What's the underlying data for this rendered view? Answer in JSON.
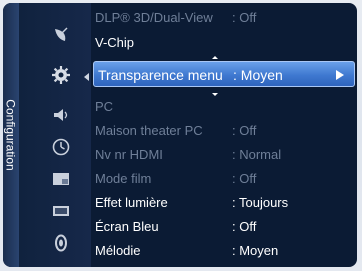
{
  "menu": {
    "section_label": "Configuration",
    "side_icons": [
      "satellite-dish-icon",
      "gear-icon",
      "speaker-icon",
      "clock-icon",
      "picture-in-picture-icon",
      "screen-icon",
      "input-source-icon"
    ],
    "rows": [
      {
        "label": "DLP® 3D/Dual-View",
        "value": ": Off",
        "state": "dim"
      },
      {
        "label": "V-Chip",
        "value": "",
        "state": "normal"
      },
      {
        "label": "Transparence menu",
        "value": ": Moyen",
        "state": "selected"
      },
      {
        "label": "PC",
        "value": "",
        "state": "dim"
      },
      {
        "label": "Maison theater PC",
        "value": ": Off",
        "state": "dim"
      },
      {
        "label": "Nv nr HDMI",
        "value": ": Normal",
        "state": "dim"
      },
      {
        "label": "Mode film",
        "value": ": Off",
        "state": "dim"
      },
      {
        "label": "Effet lumière",
        "value": ": Toujours",
        "state": "normal"
      },
      {
        "label": "Écran Bleu",
        "value": ": Off",
        "state": "normal"
      },
      {
        "label": "Mélodie",
        "value": ": Moyen",
        "state": "normal"
      }
    ]
  },
  "colors": {
    "panel_bg": "#0b1b34",
    "highlight": "#3f79d0",
    "text": "#ffffff",
    "dim_text": "#6f7f98"
  }
}
